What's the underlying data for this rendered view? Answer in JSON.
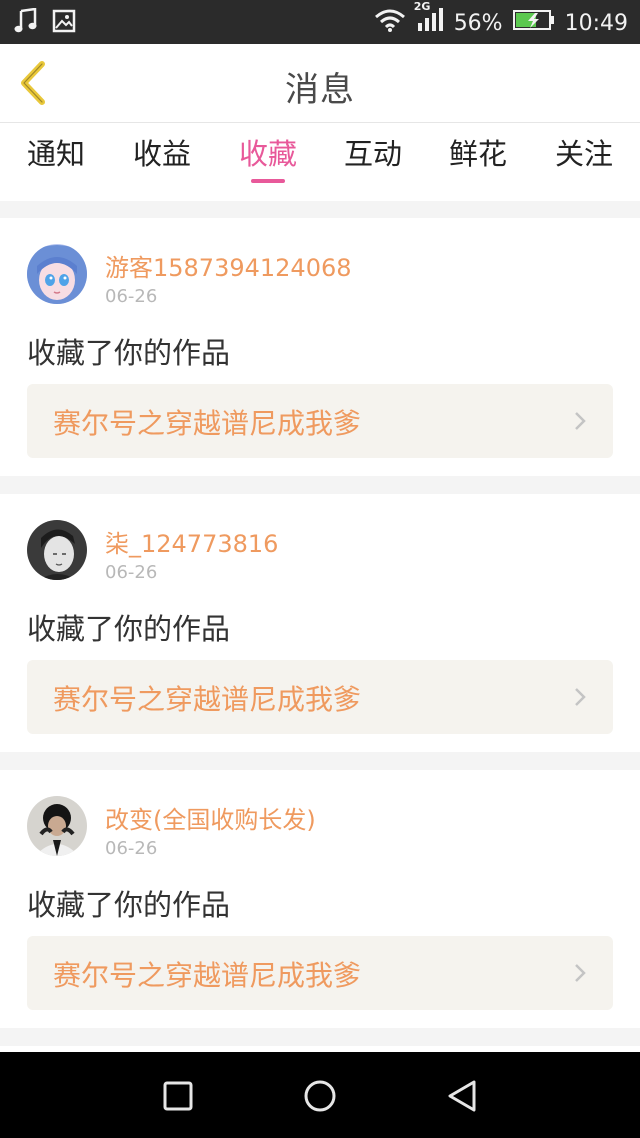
{
  "status_bar": {
    "network": "2G",
    "battery": "56%",
    "time": "10:49"
  },
  "header": {
    "title": "消息"
  },
  "tabs": [
    {
      "label": "通知"
    },
    {
      "label": "收益"
    },
    {
      "label": "收藏",
      "active": true
    },
    {
      "label": "互动"
    },
    {
      "label": "鲜花"
    },
    {
      "label": "关注"
    }
  ],
  "messages": [
    {
      "username": "游客1587394124068",
      "date": "06-26",
      "action": "收藏了你的作品",
      "work_title": "赛尔号之穿越谱尼成我爹",
      "avatar": "anime-girl-avatar"
    },
    {
      "username": "柒_124773816",
      "date": "06-26",
      "action": "收藏了你的作品",
      "work_title": "赛尔号之穿越谱尼成我爹",
      "avatar": "anime-boy-avatar"
    },
    {
      "username": "改变(全国收购长发)",
      "date": "06-26",
      "action": "收藏了你的作品",
      "work_title": "赛尔号之穿越谱尼成我爹",
      "avatar": "person-photo-avatar"
    }
  ],
  "colors": {
    "accent": "#e8599a",
    "username": "#ef9a5f",
    "back_arrow": "#e9c83a"
  }
}
